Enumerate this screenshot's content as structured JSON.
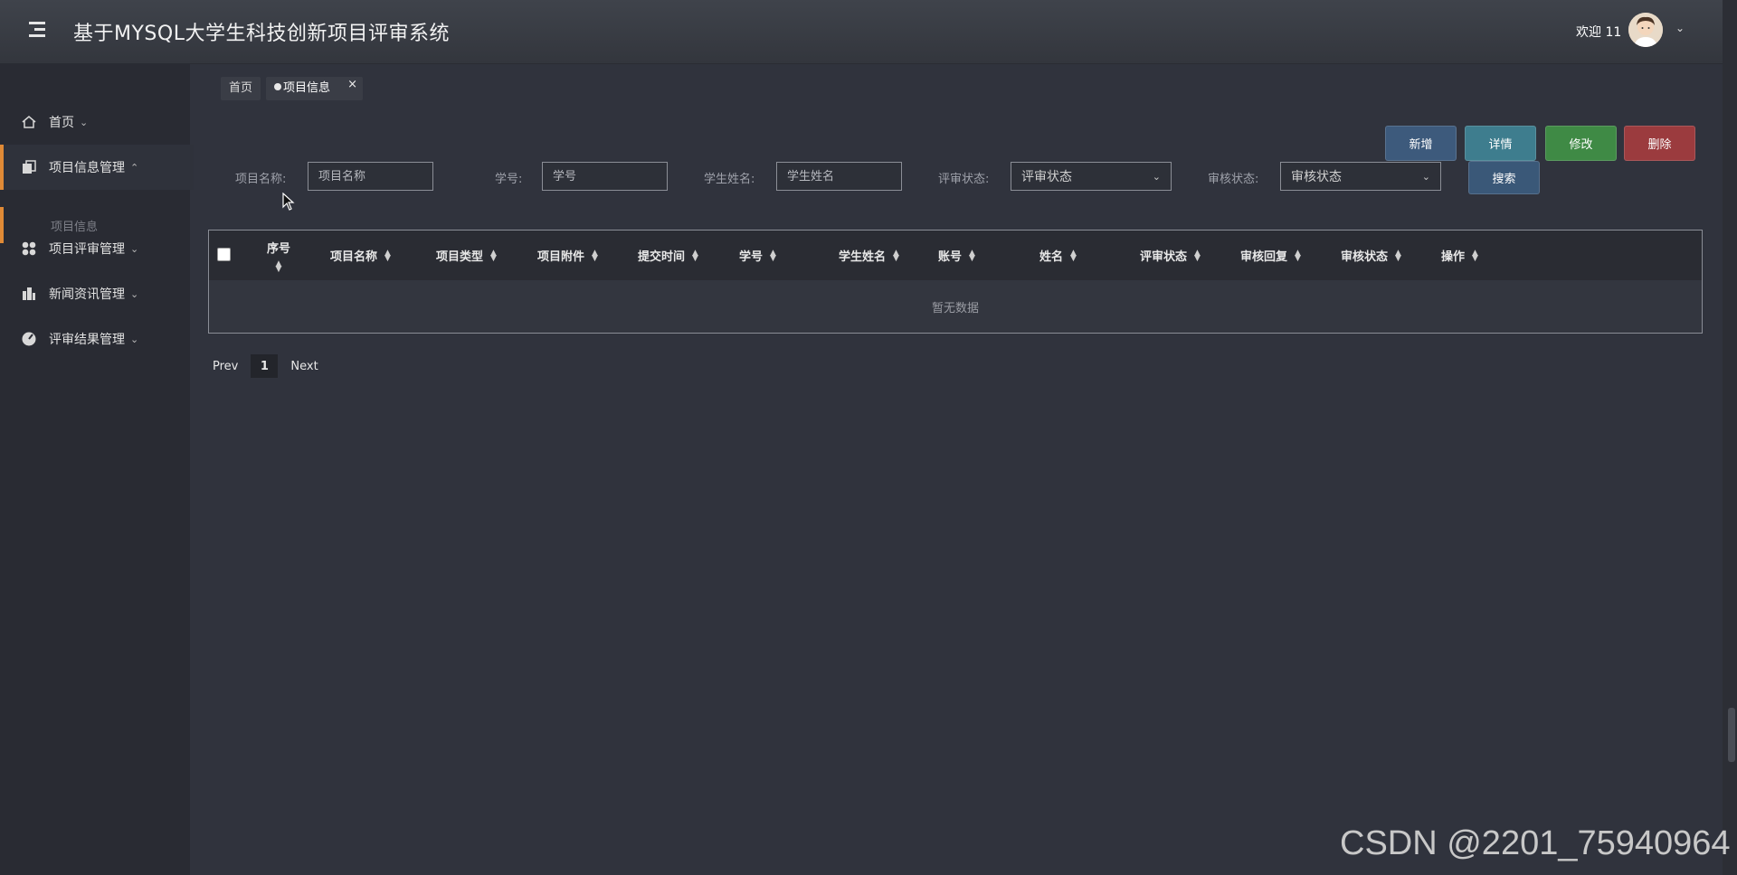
{
  "header": {
    "title": "基于MYSQL大学生科技创新项目评审系统",
    "welcome": "欢迎 11"
  },
  "sidebar": {
    "items": [
      {
        "label": "首页",
        "icon": "home-icon"
      },
      {
        "label": "项目信息管理",
        "icon": "copy-icon",
        "expanded": true
      },
      {
        "label": "项目评审管理",
        "icon": "grid-icon"
      },
      {
        "label": "新闻资讯管理",
        "icon": "building-icon"
      },
      {
        "label": "评审结果管理",
        "icon": "dashboard-icon"
      }
    ],
    "subitem": "项目信息"
  },
  "tabs": [
    {
      "label": "首页"
    },
    {
      "label": "项目信息",
      "close": "×"
    }
  ],
  "actions": {
    "add": "新增",
    "detail": "详情",
    "edit": "修改",
    "delete": "删除",
    "search": "搜索"
  },
  "filters": {
    "project_name_label": "项目名称:",
    "project_name_placeholder": "项目名称",
    "student_no_label": "学号:",
    "student_no_placeholder": "学号",
    "student_name_label": "学生姓名:",
    "student_name_placeholder": "学生姓名",
    "review_status_label": "评审状态:",
    "review_status_value": "评审状态",
    "audit_status_label": "审核状态:",
    "audit_status_value": "审核状态"
  },
  "table": {
    "columns": [
      "序号",
      "项目名称",
      "项目类型",
      "项目附件",
      "提交时间",
      "学号",
      "学生姓名",
      "账号",
      "姓名",
      "评审状态",
      "审核回复",
      "审核状态",
      "操作"
    ],
    "empty_text": "暂无数据"
  },
  "pager": {
    "prev": "Prev",
    "page": "1",
    "next": "Next"
  },
  "watermark": "CSDN @2201_75940964"
}
